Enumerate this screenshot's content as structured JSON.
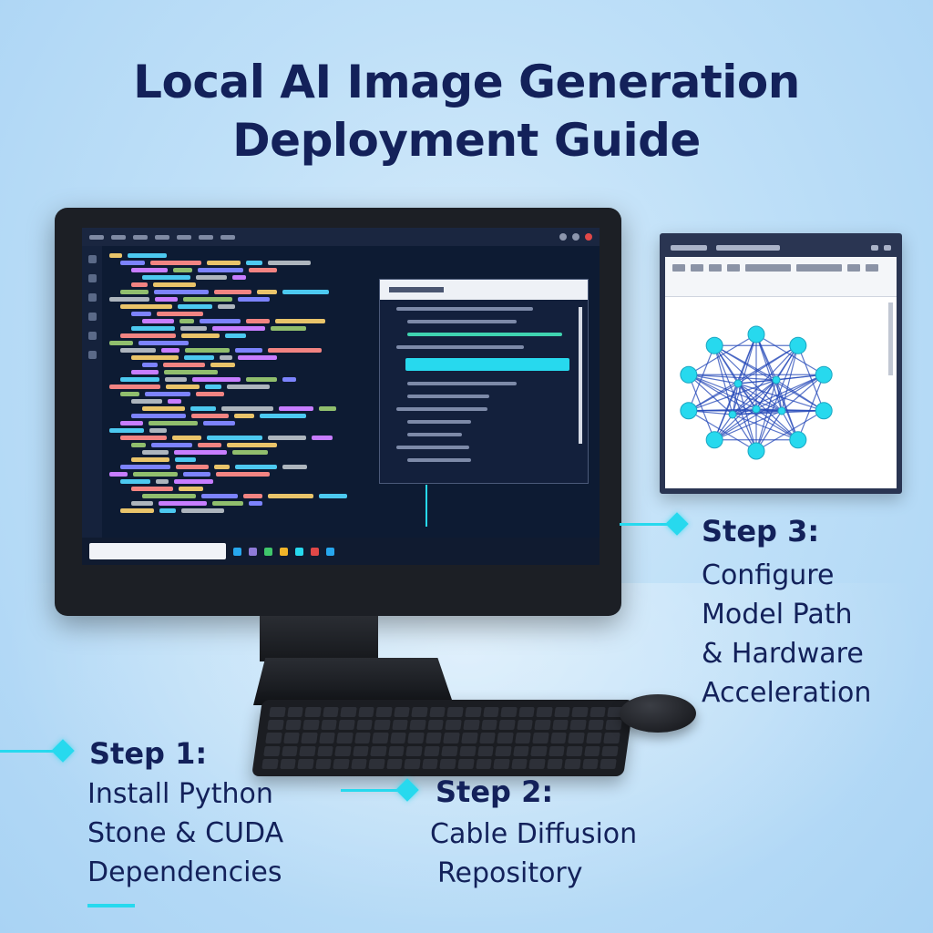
{
  "title_line1": "Local AI Image Generation",
  "title_line2": "Deployment Guide",
  "steps": [
    {
      "heading": "Step 1:",
      "lines": [
        "Install Python",
        "Stone & CUDA",
        "Dependencies"
      ]
    },
    {
      "heading": "Step 2:",
      "lines": [
        "Cable Diffusion",
        "Repository"
      ]
    },
    {
      "heading": "Step 3:",
      "lines": [
        "Configure",
        "Model Path",
        "& Hardware",
        "Acceleration"
      ]
    }
  ],
  "colors": {
    "accent": "#27d9ee",
    "title": "#13215a",
    "background": "#bfe0f8",
    "screen": "#0d1b33"
  },
  "icons": [
    "monitor",
    "keyboard",
    "mouse",
    "neural-network-diagram"
  ]
}
